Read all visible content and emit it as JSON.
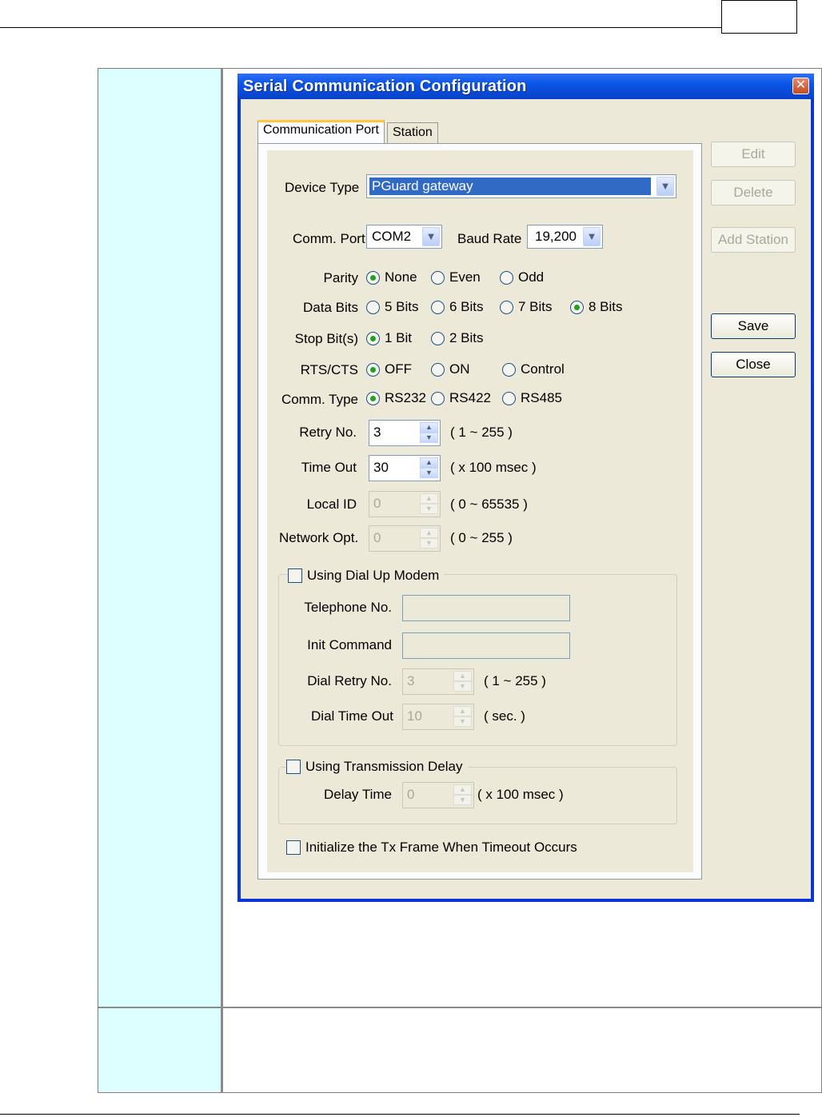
{
  "dialog": {
    "title": "Serial Communication Configuration",
    "close_symbol": "✕"
  },
  "tabs": [
    "Communication Port",
    "Station"
  ],
  "buttons": {
    "edit": "Edit",
    "delete": "Delete",
    "add_station": "Add Station",
    "save": "Save",
    "close": "Close"
  },
  "form": {
    "device_type": {
      "label": "Device Type",
      "value": "PGuard gateway"
    },
    "comm_port": {
      "label": "Comm. Port",
      "value": "COM2"
    },
    "baud_rate": {
      "label": "Baud Rate",
      "value": "19,200"
    },
    "parity": {
      "label": "Parity",
      "options": [
        "None",
        "Even",
        "Odd"
      ],
      "selected": "None"
    },
    "data_bits": {
      "label": "Data Bits",
      "options": [
        "5 Bits",
        "6 Bits",
        "7 Bits",
        "8 Bits"
      ],
      "selected": "8 Bits"
    },
    "stop_bits": {
      "label": "Stop Bit(s)",
      "options": [
        "1 Bit",
        "2 Bits"
      ],
      "selected": "1 Bit"
    },
    "rts_cts": {
      "label": "RTS/CTS",
      "options": [
        "OFF",
        "ON",
        "Control"
      ],
      "selected": "OFF"
    },
    "comm_type": {
      "label": "Comm. Type",
      "options": [
        "RS232",
        "RS422",
        "RS485"
      ],
      "selected": "RS232"
    },
    "retry_no": {
      "label": "Retry No.",
      "value": "3",
      "hint": "( 1 ~ 255 )"
    },
    "time_out": {
      "label": "Time Out",
      "value": "30",
      "hint": "( x 100 msec )"
    },
    "local_id": {
      "label": "Local ID",
      "value": "0",
      "hint": "( 0 ~ 65535 )"
    },
    "network_opt": {
      "label": "Network Opt.",
      "value": "0",
      "hint": "( 0 ~ 255 )"
    },
    "dial_up": {
      "label": "Using Dial Up Modem",
      "telephone_label": "Telephone No.",
      "init_label": "Init Command",
      "dial_retry": {
        "label": "Dial Retry No.",
        "value": "3",
        "hint": "( 1 ~ 255 )"
      },
      "dial_timeout": {
        "label": "Dial Time Out",
        "value": "10",
        "hint": "( sec. )"
      }
    },
    "tx_delay": {
      "label": "Using Transmission Delay",
      "delay_time": {
        "label": "Delay Time",
        "value": "0",
        "hint": "( x 100 msec )"
      }
    },
    "init_tx": {
      "label": "Initialize the Tx Frame When Timeout  Occurs"
    }
  }
}
